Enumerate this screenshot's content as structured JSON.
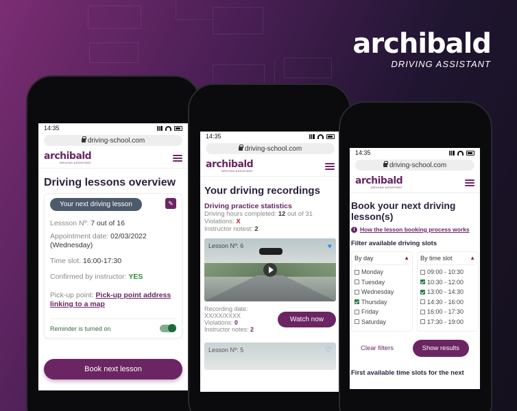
{
  "brand": {
    "name": "archibald",
    "subtitle": "DRIVING ASSISTANT"
  },
  "colors": {
    "accent": "#6b2563",
    "success": "#2d8a3a",
    "danger": "#c0182c"
  },
  "common": {
    "time": "14:35",
    "url": "driving-school.com",
    "logo_name": "archibald",
    "logo_sub": "DRIVING ASSISTANT"
  },
  "phone1": {
    "title": "Driving lessons overview",
    "pill": "Your next driving lesson",
    "lesson_label": "Lessson Nº:",
    "lesson_value": "7 out of 16",
    "date_label": "Appointment date:",
    "date_value": "02/03/2022",
    "date_day": "(Wednesday)",
    "slot_label": "Time slot:",
    "slot_value": "16:00-17:30",
    "confirm_label": "Confirmed by instructor:",
    "confirm_value": "YES",
    "pickup_label": "Pick-up point:",
    "pickup_link": "Pick-up point address linking to a map",
    "reminder": "Reminder is turned on",
    "book_btn": "Book next lesson"
  },
  "phone2": {
    "title": "Your driving recordings",
    "stats_title": "Driving practice statistics",
    "hours_label": "Driving hours completed:",
    "hours_value": "12",
    "hours_total": "out of 31",
    "violations_label": "Violations:",
    "violations_value": "X",
    "notes_label": "Instructor notest:",
    "notes_value": "2",
    "video1_caption": "Lesson Nº: 6",
    "rec_date_label": "Recording date:",
    "rec_date_value": "XX/XX/XXXX",
    "rec_viol_label": "Violations:",
    "rec_viol_value": "0",
    "rec_notes_label": "Instructor notes:",
    "rec_notes_value": "2",
    "watch_btn": "Watch now",
    "video2_caption": "Lesson Nº: 5"
  },
  "phone3": {
    "title": "Book your next driving lesson(s)",
    "how_link": "How the lesson booking process works",
    "filter_title": "Filter available driving slots",
    "day_head": "By day",
    "time_head": "By time slot",
    "days": [
      {
        "label": "Monday",
        "checked": false
      },
      {
        "label": "Tuesday",
        "checked": false
      },
      {
        "label": "Wednesday",
        "checked": false
      },
      {
        "label": "Thursday",
        "checked": true
      },
      {
        "label": "Friday",
        "checked": false
      },
      {
        "label": "Saturday",
        "checked": false
      }
    ],
    "slots": [
      {
        "label": "09:00 - 10:30",
        "checked": false
      },
      {
        "label": "10:30 - 12:00",
        "checked": true
      },
      {
        "label": "13:00 - 14:30",
        "checked": true
      },
      {
        "label": "14:30 - 16:00",
        "checked": false
      },
      {
        "label": "16:00 - 17:30",
        "checked": false
      },
      {
        "label": "17:30 - 19:00",
        "checked": false
      }
    ],
    "clear_btn": "Clear filters",
    "show_btn": "Show results",
    "first_slots": "First available time slots for the next"
  }
}
